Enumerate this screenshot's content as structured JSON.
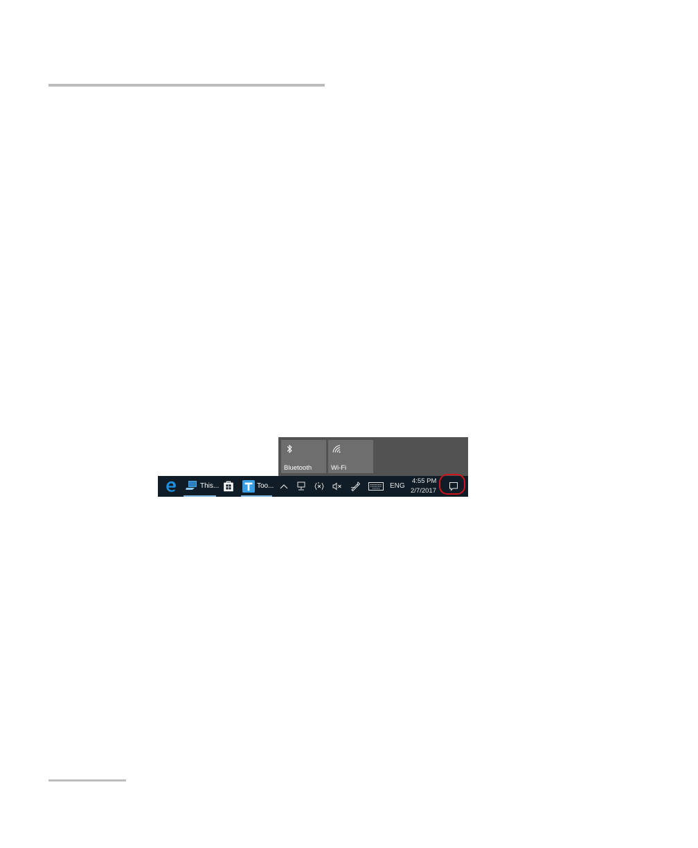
{
  "quick_actions": {
    "tiles": [
      {
        "label": "Bluetooth",
        "icon": "bluetooth-icon"
      },
      {
        "label": "Wi-Fi",
        "icon": "wifi-icon"
      }
    ]
  },
  "taskbar": {
    "apps": [
      {
        "label": "",
        "icon": "edge-browser-icon"
      },
      {
        "label": "This...",
        "icon": "this-pc-icon",
        "active": true
      },
      {
        "label": "",
        "icon": "store-icon"
      },
      {
        "label": "Too...",
        "icon": "toolbox-app-icon",
        "active": true
      }
    ],
    "tray": {
      "language": "ENG",
      "time": "4:55 PM",
      "date": "2/7/2017"
    }
  },
  "colors": {
    "taskbar_bg": "#101c26",
    "panel_bg": "#525252",
    "tile_bg": "#6e6e6e",
    "highlight": "#d0141c",
    "active_underline": "#7fb2dd"
  }
}
